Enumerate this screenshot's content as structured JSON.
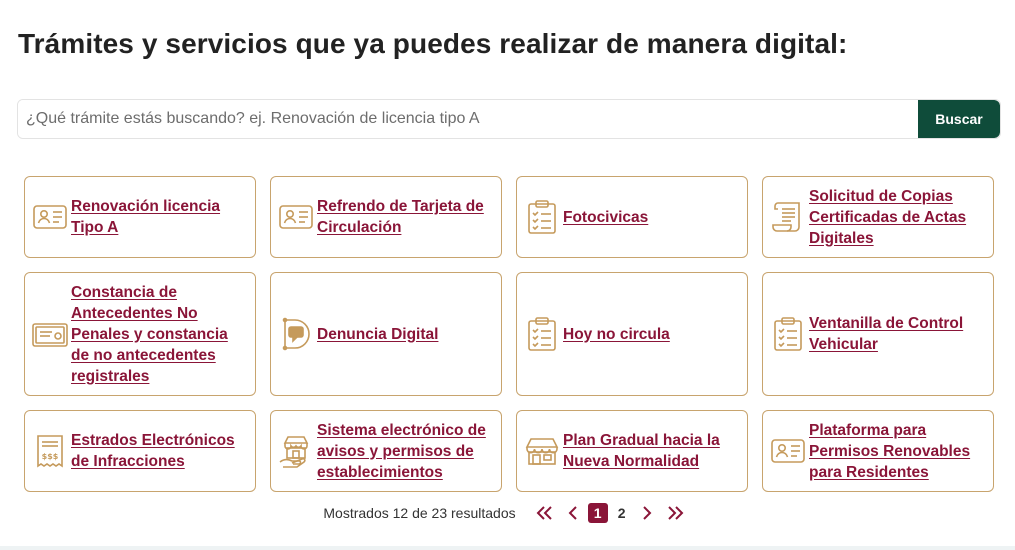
{
  "page": {
    "title": "Trámites y servicios que ya puedes realizar de manera digital:"
  },
  "search": {
    "placeholder": "¿Qué trámite estás buscando? ej. Renovación de licencia tipo A",
    "value": "",
    "button_label": "Buscar"
  },
  "colors": {
    "accent": "#8a1538",
    "button_green": "#0f4c3a",
    "card_border": "#c8a46e",
    "icon_gold": "#c59a5b"
  },
  "cards": [
    {
      "label": "Renovación licencia Tipo A",
      "icon": "id-card-icon"
    },
    {
      "label": "Refrendo de Tarjeta de Circulación",
      "icon": "id-card-icon"
    },
    {
      "label": "Fotocivicas",
      "icon": "clipboard-checklist-icon"
    },
    {
      "label": "Solicitud de Copias Certificadas de Actas Digitales",
      "icon": "scroll-document-icon"
    },
    {
      "label": "Constancia de Antecedentes No Penales y constancia de no antecedentes registrales",
      "icon": "certificate-icon"
    },
    {
      "label": "Denuncia Digital",
      "icon": "digital-report-icon"
    },
    {
      "label": "Hoy no circula",
      "icon": "clipboard-checklist-icon"
    },
    {
      "label": "Ventanilla de Control Vehicular",
      "icon": "clipboard-checklist-icon"
    },
    {
      "label": "Estrados Electrónicos de Infracciones",
      "icon": "receipt-icon"
    },
    {
      "label": "Sistema electrónico de avisos y permisos de establecimientos",
      "icon": "store-hand-icon"
    },
    {
      "label": "Plan Gradual hacia la Nueva Normalidad",
      "icon": "storefront-icon"
    },
    {
      "label": "Plataforma para Permisos Renovables para Residentes",
      "icon": "id-card-icon"
    }
  ],
  "pagination": {
    "results_text": "Mostrados 12 de 23 resultados",
    "pages": [
      "1",
      "2"
    ],
    "current_page": "1"
  }
}
